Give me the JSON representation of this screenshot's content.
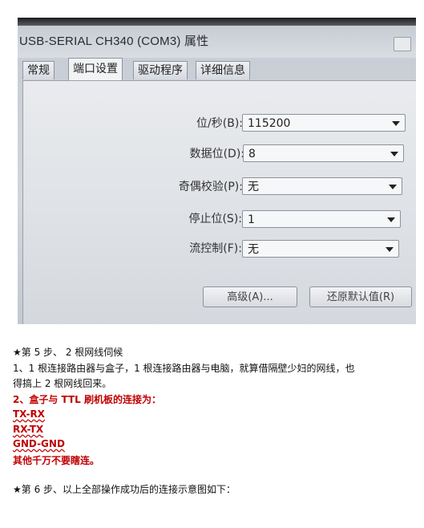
{
  "dialog": {
    "title": "USB-SERIAL CH340 (COM3) 属性",
    "tabs": [
      "常规",
      "端口设置",
      "驱动程序",
      "详细信息"
    ],
    "active_tab": "端口设置",
    "fields": [
      {
        "label": "位/秒(B):",
        "value": "115200"
      },
      {
        "label": "数据位(D):",
        "value": "8"
      },
      {
        "label": "奇偶校验(P):",
        "value": "无"
      },
      {
        "label": "停止位(S):",
        "value": "1"
      },
      {
        "label": "流控制(F):",
        "value": "无"
      }
    ],
    "advanced_button": "高级(A)...",
    "restore_button": "还原默认值(R)"
  },
  "doc": {
    "step5_title": "★第 5 步、 2 根网线伺候",
    "step5_body_1": "1、1 根连接路由器与盒子，1 根连接路由器与电脑，就算借隔壁少妇的网线，也",
    "step5_body_2": "得搞上 2 根网线回来。",
    "conn_title": "2、盒子与 TTL 刷机板的连接为：",
    "conn_1": "TX-RX",
    "conn_2": "RX-TX",
    "conn_3": "GND-GND",
    "warning": "其他千万不要瞎连。",
    "step6_title": "★第 6 步、以上全部操作成功后的连接示意图如下："
  }
}
